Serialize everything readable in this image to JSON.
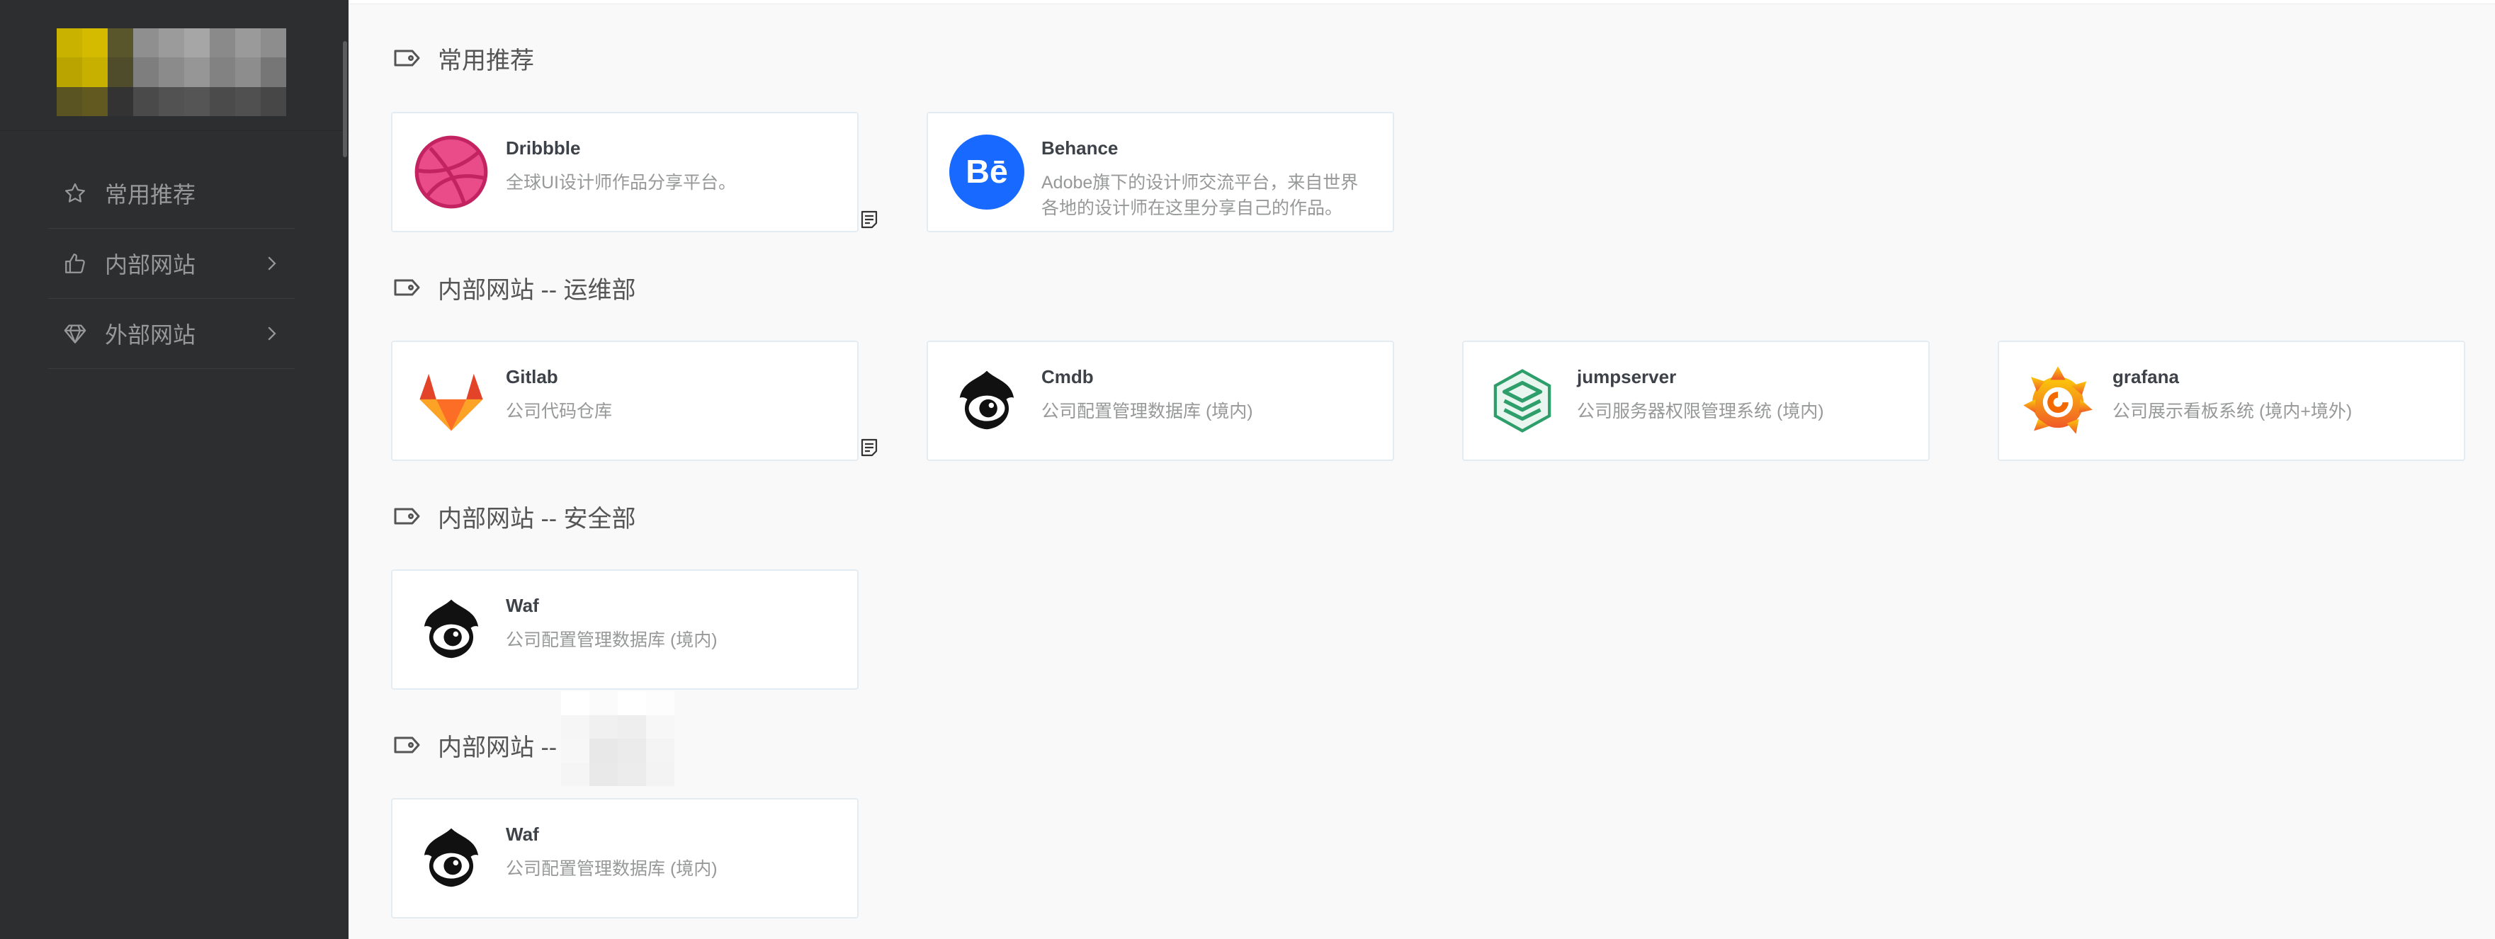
{
  "sidebar": {
    "menu": [
      {
        "label": "常用推荐",
        "icon": "star-icon"
      },
      {
        "label": "内部网站",
        "icon": "thumbs-up-icon"
      },
      {
        "label": "外部网站",
        "icon": "diamond-icon"
      }
    ]
  },
  "sections": [
    {
      "title": "常用推荐",
      "cards": [
        {
          "title": "Dribbble",
          "description": "全球UI设计师作品分享平台。",
          "icon": "dribbble-icon"
        },
        {
          "title": "Behance",
          "description": "Adobe旗下的设计师交流平台，来自世界各地的设计师在这里分享自己的作品。",
          "icon": "behance-icon"
        }
      ]
    },
    {
      "title": "内部网站 -- 运维部",
      "cards": [
        {
          "title": "Gitlab",
          "description": "公司代码仓库",
          "icon": "gitlab-icon"
        },
        {
          "title": "Cmdb",
          "description": "公司配置管理数据库 (境内)",
          "icon": "eye-logo-icon"
        },
        {
          "title": "jumpserver",
          "description": "公司服务器权限管理系统 (境内)",
          "icon": "jumpserver-icon"
        },
        {
          "title": "grafana",
          "description": "公司展示看板系统 (境内+境外)",
          "icon": "grafana-icon"
        }
      ]
    },
    {
      "title": "内部网站 -- 安全部",
      "cards": [
        {
          "title": "Waf",
          "description": "公司配置管理数据库 (境内)",
          "icon": "eye-logo-icon"
        }
      ]
    },
    {
      "title": "内部网站 --",
      "cards": [
        {
          "title": "Waf",
          "description": "公司配置管理数据库 (境内)",
          "icon": "eye-logo-icon"
        }
      ]
    }
  ],
  "colors": {
    "sidebar_bg": "#2c2e2f",
    "main_bg": "#f9f9f9",
    "card_border": "#e4ecf3",
    "dribbble": "#ea4c89",
    "behance": "#1769ff",
    "gitlab": "#fc6d26",
    "jumpserver": "#2e9e6b",
    "grafana": "#f46800"
  }
}
